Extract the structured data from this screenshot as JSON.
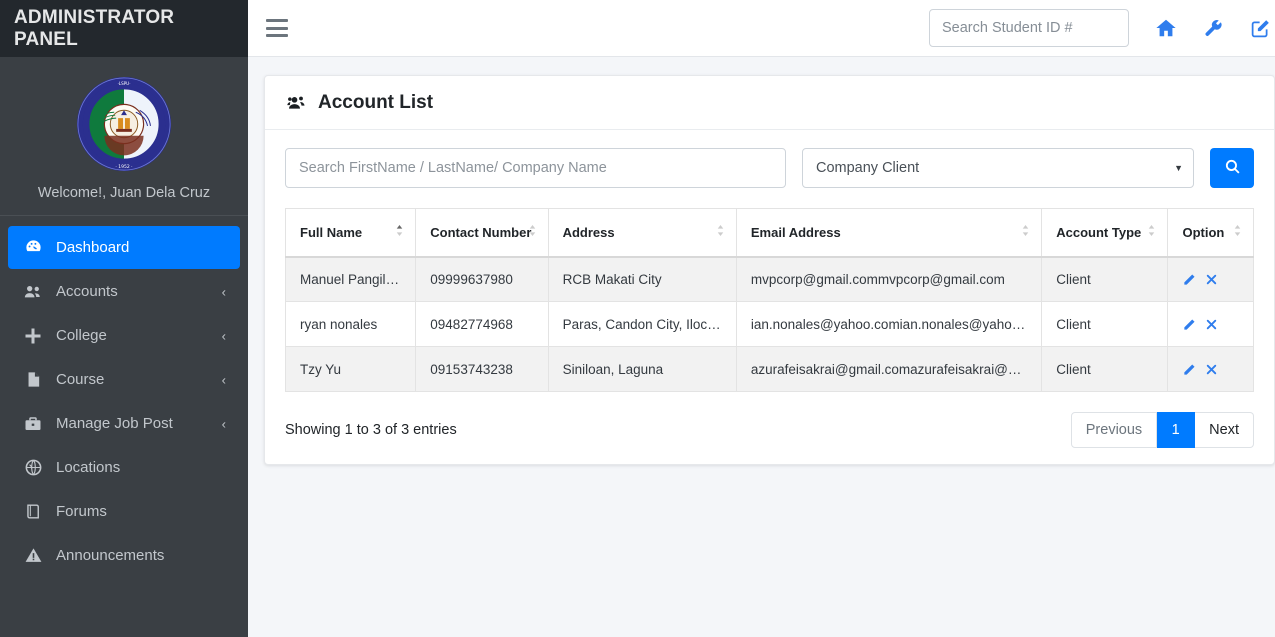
{
  "sidebar": {
    "brand": "ADMINISTRATOR PANEL",
    "logo_alt": "Laguna State Polytechnic University seal",
    "welcome": "Welcome!, Juan Dela Cruz",
    "items": [
      {
        "label": "Dashboard",
        "icon": "dashboard-icon",
        "active": true,
        "caret": ""
      },
      {
        "label": "Accounts",
        "icon": "users-icon",
        "active": false,
        "caret": "‹"
      },
      {
        "label": "College",
        "icon": "plus-icon",
        "active": false,
        "caret": "‹"
      },
      {
        "label": "Course",
        "icon": "file-icon",
        "active": false,
        "caret": "‹"
      },
      {
        "label": "Manage Job Post",
        "icon": "briefcase-icon",
        "active": false,
        "caret": "‹"
      },
      {
        "label": "Locations",
        "icon": "globe-icon",
        "active": false,
        "caret": ""
      },
      {
        "label": "Forums",
        "icon": "book-icon",
        "active": false,
        "caret": ""
      },
      {
        "label": "Announcements",
        "icon": "warning-icon",
        "active": false,
        "caret": ""
      }
    ]
  },
  "topbar": {
    "menu_icon": "hamburger-icon",
    "search_placeholder": "Search Student ID #",
    "search_value": "",
    "icons": [
      "home-icon",
      "wrench-icon",
      "pen-to-square-icon"
    ]
  },
  "card": {
    "title": "Account List",
    "title_icon": "users-group-icon",
    "filters": {
      "search_placeholder": "Search FirstName / LastName/ Company Name",
      "search_value": "",
      "account_type_selected": "Company Client",
      "account_type_options": [
        "Company Client"
      ],
      "search_button_icon": "search-icon"
    },
    "table": {
      "columns": [
        {
          "label": "Full Name",
          "sort": "asc"
        },
        {
          "label": "Contact Number",
          "sort": "none"
        },
        {
          "label": "Address",
          "sort": "none"
        },
        {
          "label": "Email Address",
          "sort": "none"
        },
        {
          "label": "Account Type",
          "sort": "none"
        },
        {
          "label": "Option",
          "sort": "none"
        }
      ],
      "rows": [
        {
          "full_name": "Manuel Pangilinan",
          "contact_number": "09999637980",
          "address": "RCB Makati City",
          "email": "mvpcorp@gmail.commvpcorp@gmail.com",
          "account_type": "Client"
        },
        {
          "full_name": "ryan nonales",
          "contact_number": "09482774968",
          "address": "Paras, Candon City, Ilocos Sur",
          "email": "ian.nonales@yahoo.comian.nonales@yahoo.com",
          "account_type": "Client"
        },
        {
          "full_name": "Tzy Yu",
          "contact_number": "09153743238",
          "address": "Siniloan, Laguna",
          "email": "azurafeisakrai@gmail.comazurafeisakrai@gmail.com",
          "account_type": "Client"
        }
      ],
      "row_action_icons": [
        "edit-pencil-icon",
        "delete-x-icon"
      ]
    },
    "footer": {
      "showing": "Showing 1 to 3 of 3 entries",
      "pagination": {
        "previous": "Previous",
        "pages": [
          "1"
        ],
        "active_page": "1",
        "next": "Next"
      }
    }
  },
  "colors": {
    "accent": "#007bff",
    "sidebar_bg": "#3a3f44",
    "sidebar_header_bg": "#23282d",
    "content_bg": "#f4f6f9",
    "row_stripe": "#f2f2f2"
  }
}
